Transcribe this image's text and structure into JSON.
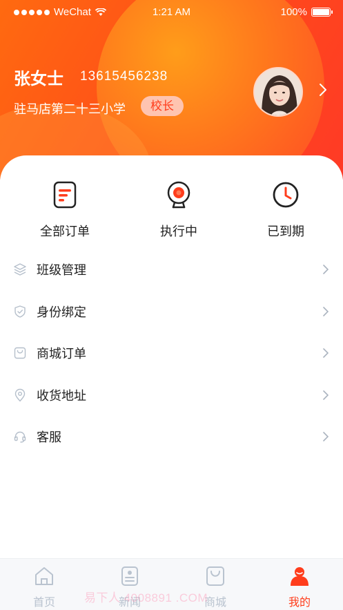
{
  "status_bar": {
    "carrier": "WeChat",
    "time": "1:21 AM",
    "battery": "100%"
  },
  "profile": {
    "name": "张女士",
    "phone": "13615456238",
    "school": "驻马店第二十三小学",
    "role": "校长"
  },
  "quick_actions": [
    {
      "label": "全部订单",
      "icon": "order-list-icon"
    },
    {
      "label": "执行中",
      "icon": "camera-icon"
    },
    {
      "label": "已到期",
      "icon": "clock-icon"
    }
  ],
  "menu": [
    {
      "label": "班级管理",
      "icon": "layers-icon"
    },
    {
      "label": "身份绑定",
      "icon": "shield-check-icon"
    },
    {
      "label": "商城订单",
      "icon": "shopping-bag-icon"
    },
    {
      "label": "收货地址",
      "icon": "location-pin-icon"
    },
    {
      "label": "客服",
      "icon": "headset-icon"
    }
  ],
  "tabbar": [
    {
      "label": "首页",
      "icon": "home-icon",
      "active": false
    },
    {
      "label": "新闻",
      "icon": "news-icon",
      "active": false
    },
    {
      "label": "商城",
      "icon": "shop-bag-icon",
      "active": false
    },
    {
      "label": "我的",
      "icon": "user-icon",
      "active": true
    }
  ],
  "watermark": "易下人 4008891 .COM",
  "colors": {
    "accent": "#ff3d1c",
    "header_start": "#ff6a10",
    "header_end": "#ff3a26",
    "inactive_tab": "#b9c3cf"
  }
}
